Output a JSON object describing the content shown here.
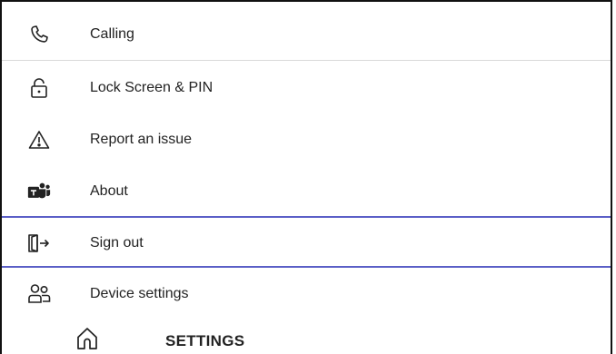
{
  "menu": {
    "items": [
      {
        "id": "calling",
        "label": "Calling",
        "icon": "phone-icon"
      },
      {
        "id": "lock",
        "label": "Lock Screen & PIN",
        "icon": "lock-icon"
      },
      {
        "id": "report",
        "label": "Report an issue",
        "icon": "warning-icon"
      },
      {
        "id": "about",
        "label": "About",
        "icon": "teams-logo-icon"
      },
      {
        "id": "signout",
        "label": "Sign out",
        "icon": "sign-out-icon"
      },
      {
        "id": "device",
        "label": "Device settings",
        "icon": "people-icon"
      }
    ]
  },
  "bottom_bar": {
    "title": "SETTINGS",
    "home_icon": "home-icon"
  },
  "colors": {
    "accent": "#5b5fc7",
    "separator": "#d9d9d9",
    "text": "#222222"
  }
}
